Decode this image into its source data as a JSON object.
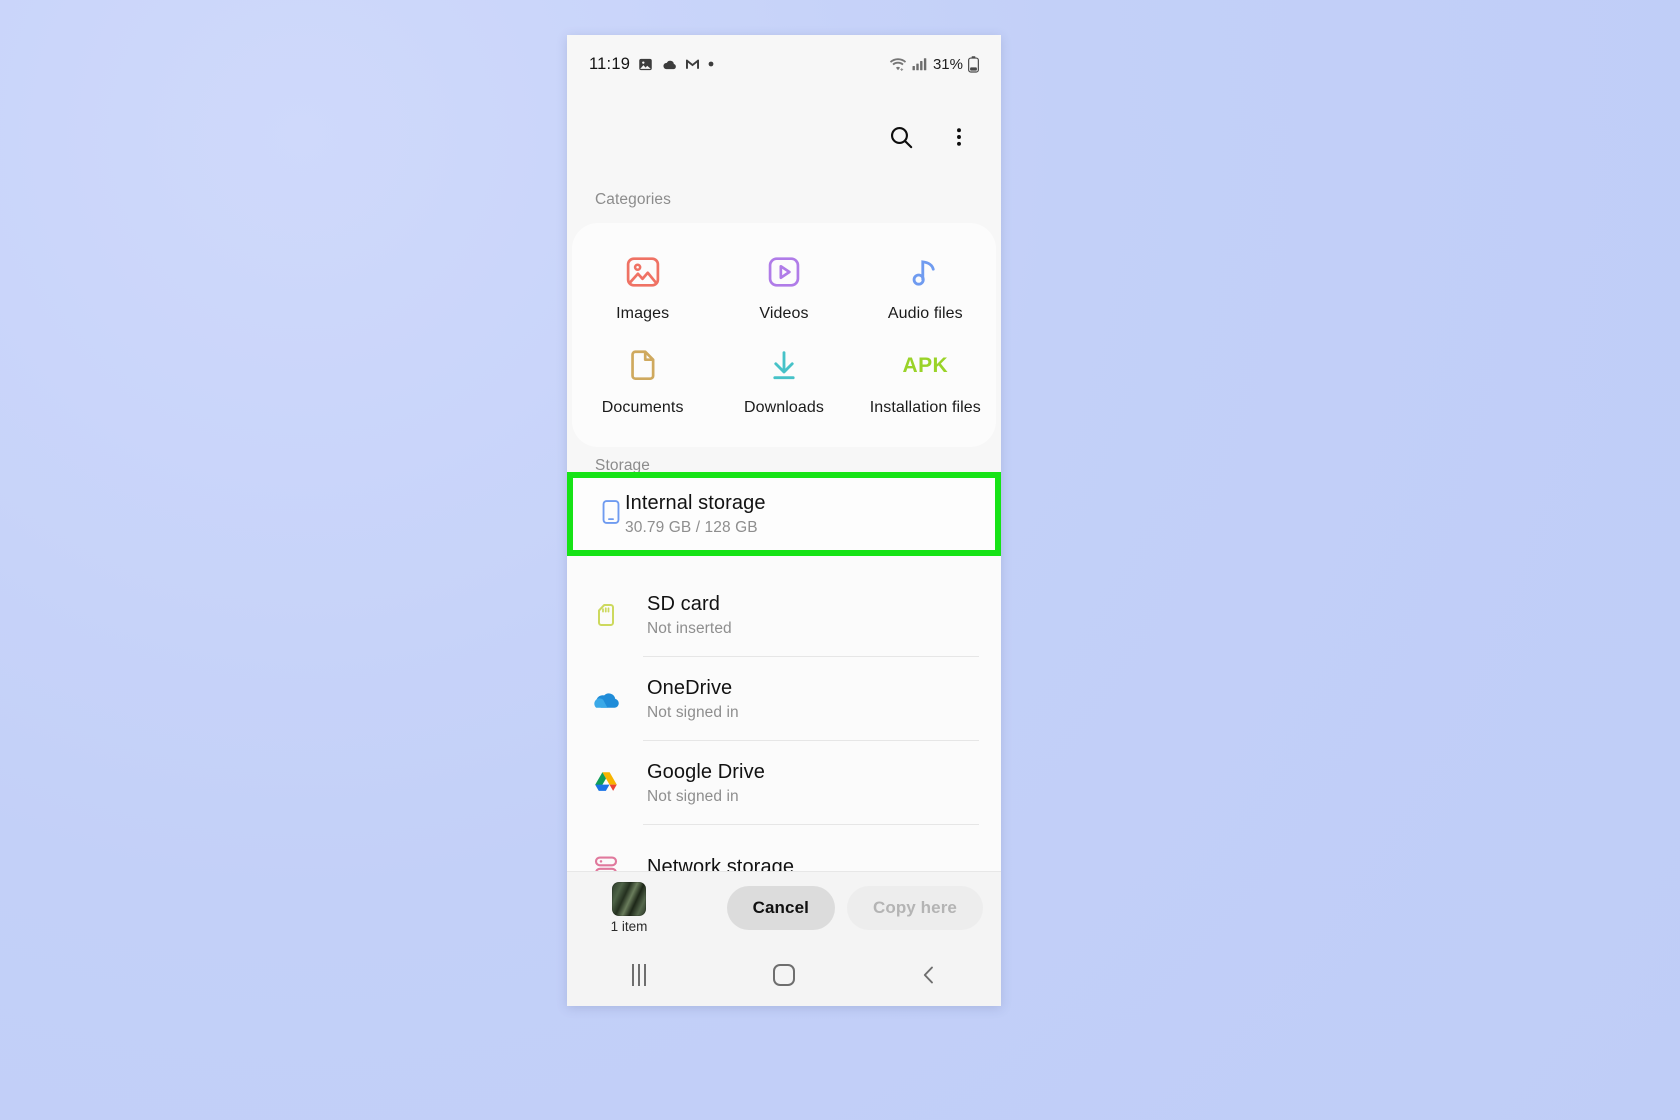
{
  "statusbar": {
    "time": "11:19",
    "left_icons": [
      "photos-icon",
      "cloud-icon",
      "gmail-icon",
      "dot-icon"
    ],
    "wifi_icon": "wifi-icon",
    "signal_icon": "cellular-signal-icon",
    "battery_percent": "31%",
    "battery_icon": "battery-icon"
  },
  "appbar": {
    "search_icon": "search-icon",
    "more_icon": "more-vertical-icon"
  },
  "categories": {
    "section_label": "Categories",
    "items": [
      {
        "label": "Images",
        "icon": "image-icon",
        "color": "#ef7264"
      },
      {
        "label": "Videos",
        "icon": "video-play-icon",
        "color": "#b07ce8"
      },
      {
        "label": "Audio files",
        "icon": "music-note-icon",
        "color": "#6f9bf0"
      },
      {
        "label": "Documents",
        "icon": "document-icon",
        "color": "#cfa95e"
      },
      {
        "label": "Downloads",
        "icon": "download-icon",
        "color": "#46c2c8"
      },
      {
        "label": "Installation files",
        "icon": "apk-icon",
        "color": "#9ad329",
        "glyph": "APK"
      }
    ]
  },
  "storage": {
    "section_label": "Storage",
    "items": [
      {
        "title": "Internal storage",
        "subtitle": "30.79 GB / 128 GB",
        "icon": "phone-icon",
        "highlighted": true
      },
      {
        "title": "SD card",
        "subtitle": "Not inserted",
        "icon": "sd-card-icon",
        "highlighted": false
      },
      {
        "title": "OneDrive",
        "subtitle": "Not signed in",
        "icon": "onedrive-icon",
        "highlighted": false
      },
      {
        "title": "Google Drive",
        "subtitle": "Not signed in",
        "icon": "google-drive-icon",
        "highlighted": false
      },
      {
        "title": "Network storage",
        "subtitle": "",
        "icon": "network-storage-icon",
        "highlighted": false
      }
    ]
  },
  "actionbar": {
    "selection_count": "1 item",
    "thumbnail_icon": "selected-file-thumbnail",
    "cancel_label": "Cancel",
    "copy_label": "Copy here"
  },
  "navbar": {
    "recents_icon": "recents-icon",
    "home_icon": "home-icon",
    "back_icon": "back-icon"
  },
  "colors": {
    "highlight": "#16e316",
    "backdrop": "#c3d0f8",
    "phone_bg": "#f7f7f7"
  }
}
